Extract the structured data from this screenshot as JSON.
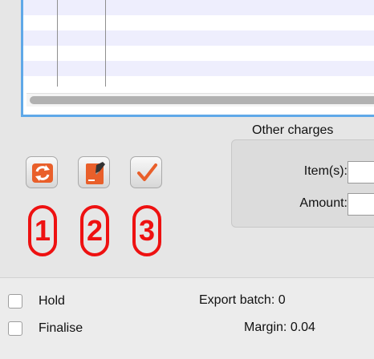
{
  "other_charges": {
    "title": "Other charges",
    "items_label": "Item(s):",
    "items_value": "",
    "amount_label": "Amount:",
    "amount_value": ""
  },
  "toolbar": {
    "buttons": [
      {
        "icon": "refresh-icon",
        "callout": "1"
      },
      {
        "icon": "edit-note-icon",
        "callout": "2"
      },
      {
        "icon": "checkmark-icon",
        "callout": "3"
      }
    ],
    "icon_color": "#e95f2a",
    "callout_color": "#ee1111"
  },
  "options": {
    "hold_label": "Hold",
    "hold_checked": false,
    "finalise_label": "Finalise",
    "finalise_checked": false
  },
  "summary": {
    "export_batch_label": "Export batch:",
    "export_batch_value": "0",
    "margin_label": "Margin:",
    "margin_value": "0.04"
  }
}
